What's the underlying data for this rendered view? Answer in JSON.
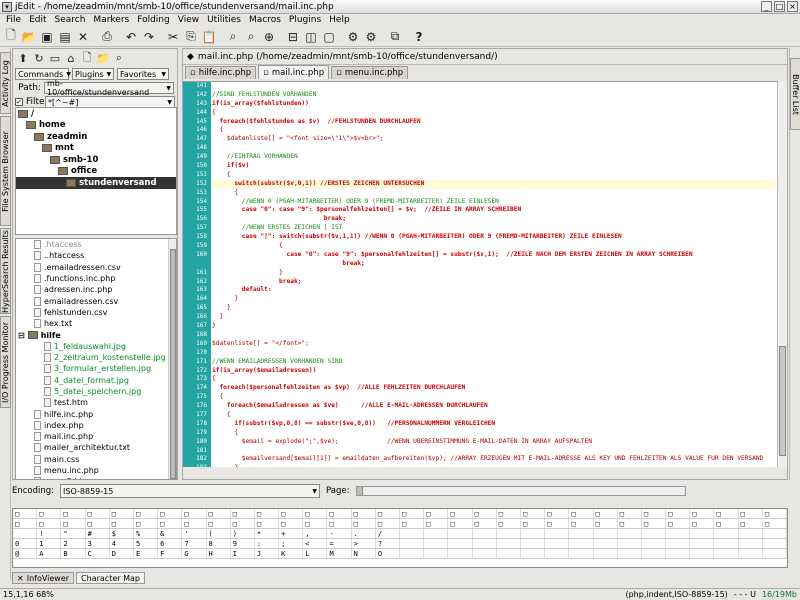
{
  "window": {
    "title": "jEdit - /home/zeadmin/mnt/smb-10/office/stundenversand/mail.inc.php"
  },
  "menu": [
    "File",
    "Edit",
    "Search",
    "Markers",
    "Folding",
    "View",
    "Utilities",
    "Macros",
    "Plugins",
    "Help"
  ],
  "left_vtabs": [
    "Activity Log",
    "File System Browser",
    "HyperSearch Results",
    "I/O Progress Monitor"
  ],
  "right_vtabs": [
    "Buffer List"
  ],
  "browser": {
    "commands": "Commands",
    "plugins": "Plugins",
    "favorites": "Favorites",
    "path_label": "Path:",
    "path_value": "mb-10/office/stundenversand",
    "filter_label": "Filter:",
    "filter_value": "*[^~#]",
    "tree": [
      "/",
      "home",
      "zeadmin",
      "mnt",
      "smb-10",
      "office",
      "stundenversand"
    ],
    "files": [
      {
        "name": ".htaccess",
        "kind": "file",
        "dim": true
      },
      {
        "name": "..htaccess",
        "kind": "file"
      },
      {
        "name": ".emailadressen.csv",
        "kind": "file"
      },
      {
        "name": ".functions.inc.php",
        "kind": "file"
      },
      {
        "name": "adressen.inc.php",
        "kind": "file"
      },
      {
        "name": "emailadressen.csv",
        "kind": "file"
      },
      {
        "name": "fehlstunden.csv",
        "kind": "file"
      },
      {
        "name": "hex.txt",
        "kind": "file"
      },
      {
        "name": "hilfe",
        "kind": "dir"
      },
      {
        "name": "1_feldauswahl.jpg",
        "kind": "sub"
      },
      {
        "name": "2_zeitraum_kostenstelle.jpg",
        "kind": "sub"
      },
      {
        "name": "3_formular_erstellen.jpg",
        "kind": "sub"
      },
      {
        "name": "4_datei_format.jpg",
        "kind": "sub"
      },
      {
        "name": "5_datei_speichern.jpg",
        "kind": "sub"
      },
      {
        "name": "test.htm",
        "kind": "subfile"
      },
      {
        "name": "hilfe.inc.php",
        "kind": "file"
      },
      {
        "name": "index.php",
        "kind": "file"
      },
      {
        "name": "mail.inc.php",
        "kind": "file"
      },
      {
        "name": "mailer_architektur.txt",
        "kind": "file"
      },
      {
        "name": "main.css",
        "kind": "file"
      },
      {
        "name": "menu.inc.php",
        "kind": "file"
      },
      {
        "name": "menu2.htm",
        "kind": "file"
      },
      {
        "name": "menu_bg.gif",
        "kind": "sub2"
      },
      {
        "name": "menu_bg2.gif",
        "kind": "sub2"
      },
      {
        "name": "Mitarbeiter+Emailadressen.xls",
        "kind": "file"
      }
    ]
  },
  "editor": {
    "title": "mail.inc.php (/home/zeadmin/mnt/smb-10/office/stundenversand/)",
    "tabs": [
      "hilfe.inc.php",
      "mail.inc.php",
      "menu.inc.php"
    ],
    "active_tab": 1,
    "lines": [
      {
        "n": "141",
        "t": "",
        "c": ""
      },
      {
        "n": "142",
        "t": "//SIND FEHLSTUNDEN VORHANDEN",
        "c": "cm"
      },
      {
        "n": "143",
        "t": "if(is_array($fehlstunden))",
        "c": "kw"
      },
      {
        "n": "144",
        "t": "{",
        "c": ""
      },
      {
        "n": "145",
        "t": "  foreach($fehlstunden as $v)  //FEHLSTUNDEN DURCHLAUFEN",
        "c": "kw"
      },
      {
        "n": "146",
        "t": "  {",
        "c": ""
      },
      {
        "n": "147",
        "t": "    $datenliste[] = \"<font size=\\\"1\\\">$v<br>\";",
        "c": ""
      },
      {
        "n": "148",
        "t": "",
        "c": ""
      },
      {
        "n": "149",
        "t": "    //EINTRAG VORHANDEN",
        "c": "cm"
      },
      {
        "n": "150",
        "t": "    if($v)",
        "c": "kw"
      },
      {
        "n": "151",
        "t": "    {",
        "c": ""
      },
      {
        "n": "152",
        "t": "      switch(substr($v,0,1)) //ERSTES ZEICHEN UNTERSUCHEN",
        "c": "kw hl"
      },
      {
        "n": "153",
        "t": "      {",
        "c": ""
      },
      {
        "n": "154",
        "t": "        //WENN 0 (PGAH-MITARBEITER) ODER 9 (FREMD-MITARBEITER) ZEILE EINLESEN",
        "c": "cm"
      },
      {
        "n": "155",
        "t": "        case \"0\": case \"9\": $personalfehlzeiten[] = $v;  //ZEILE IN ARRAY SCHREIBEN",
        "c": "kw"
      },
      {
        "n": "156",
        "t": "                              break;",
        "c": "kw"
      },
      {
        "n": "157",
        "t": "        //WENN ERSTES ZEICHEN | IST",
        "c": "cm"
      },
      {
        "n": "158",
        "t": "        case \"|\": switch(substr($v,1,1)) //WENN 0 (PGAH-MITARBEITER) ODER 9 (FREMD-MITARBEITER) ZEILE EINLESEN",
        "c": "kw"
      },
      {
        "n": "159",
        "t": "                  {",
        "c": ""
      },
      {
        "n": "160",
        "t": "                    case \"0\": case \"9\": $personalfehlzeiten[] = substr($v,1);  //ZEILE NACH DEM ERSTEN ZEICHEN IN ARRAY SCHREIBEN",
        "c": "kw"
      },
      {
        "n": "",
        "t": "                                   break;",
        "c": "kw"
      },
      {
        "n": "161",
        "t": "                  }",
        "c": ""
      },
      {
        "n": "162",
        "t": "                  break;",
        "c": "kw"
      },
      {
        "n": "163",
        "t": "        default:",
        "c": "kw"
      },
      {
        "n": "164",
        "t": "      }",
        "c": ""
      },
      {
        "n": "165",
        "t": "    }",
        "c": ""
      },
      {
        "n": "166",
        "t": "  }",
        "c": ""
      },
      {
        "n": "167",
        "t": "}",
        "c": ""
      },
      {
        "n": "168",
        "t": "",
        "c": ""
      },
      {
        "n": "169",
        "t": "$datenliste[] = \"</font>\";",
        "c": ""
      },
      {
        "n": "170",
        "t": "",
        "c": ""
      },
      {
        "n": "171",
        "t": "//WENN EMAILADRESSEN VORHANDEN SIND",
        "c": "cm"
      },
      {
        "n": "172",
        "t": "if(is_array($emailadressen))",
        "c": "kw"
      },
      {
        "n": "173",
        "t": "{",
        "c": ""
      },
      {
        "n": "174",
        "t": "  foreach($personalfehlzeiten as $vp)  //ALLE FEHLZEITEN DURCHLAUFEN",
        "c": "kw"
      },
      {
        "n": "175",
        "t": "  {",
        "c": ""
      },
      {
        "n": "176",
        "t": "    foreach($emailadressen as $ve)      //ALLE E-MAIL-ADRESSEN DURCHLAUFEN",
        "c": "kw"
      },
      {
        "n": "177",
        "t": "    {",
        "c": ""
      },
      {
        "n": "178",
        "t": "      if(substr($vp,0,8) == substr($ve,0,8))   //PERSONALNUMMERN VERGLEICHEN",
        "c": "kw"
      },
      {
        "n": "179",
        "t": "      {",
        "c": ""
      },
      {
        "n": "180",
        "t": "        $email = explode(\";\",$ve);             //WENN ÜBEREINSTIMMUNG E-MAIL-DATEN IN ARRAY AUFSPALTEN",
        "c": ""
      },
      {
        "n": "181",
        "t": "",
        "c": ""
      },
      {
        "n": "182",
        "t": "        $emailversand[$email[1]] = emaildaten_aufbereiten($vp); //ARRAY ERZEUGEN MIT E-MAIL-ADRESSE ALS KEY UND FEHLZEITEN ALS VALUE FÜR DEN VERSAND",
        "c": ""
      },
      {
        "n": "183",
        "t": "      }",
        "c": ""
      },
      {
        "n": "184",
        "t": "    }",
        "c": ""
      },
      {
        "n": "185",
        "t": "  }",
        "c": ""
      },
      {
        "n": "186",
        "t": "}",
        "c": ""
      }
    ]
  },
  "charmap": {
    "encoding_label": "Encoding:",
    "encoding_value": "ISO-8859-15",
    "page_label": "Page:",
    "rows": [
      [
        "□",
        "□",
        "□",
        "□",
        "□",
        "□",
        "□",
        "□",
        "□",
        "□",
        "□",
        "□",
        "□",
        "□",
        "□",
        "□",
        "□",
        "□",
        "□",
        "□",
        "□",
        "□",
        "□",
        "□",
        "□",
        "□",
        "□",
        "□",
        "□",
        "□",
        "□",
        "□"
      ],
      [
        "□",
        "□",
        "□",
        "□",
        "□",
        "□",
        "□",
        "□",
        "□",
        "□",
        "□",
        "□",
        "□",
        "□",
        "□",
        "□",
        "□",
        "□",
        "□",
        "□",
        "□",
        "□",
        "□",
        "□",
        "□",
        "□",
        "□",
        "□",
        "□",
        "□",
        "□",
        "□"
      ],
      [
        "",
        "!",
        "\"",
        "#",
        "$",
        "%",
        "&",
        "'",
        "(",
        ")",
        "*",
        "+",
        ",",
        "-",
        ".",
        "/",
        " ",
        " ",
        " ",
        " ",
        " ",
        " ",
        " ",
        " ",
        " ",
        " ",
        " ",
        " ",
        " ",
        " ",
        " ",
        " "
      ],
      [
        "0",
        "1",
        "2",
        "3",
        "4",
        "5",
        "6",
        "7",
        "8",
        "9",
        ":",
        ";",
        "<",
        "=",
        ">",
        "?",
        " ",
        " ",
        " ",
        " ",
        " ",
        " ",
        " ",
        " ",
        " ",
        " ",
        " ",
        " ",
        " ",
        " ",
        " ",
        " "
      ],
      [
        "@",
        "A",
        "B",
        "C",
        "D",
        "E",
        "F",
        "G",
        "H",
        "I",
        "J",
        "K",
        "L",
        "M",
        "N",
        "O",
        " ",
        " ",
        " ",
        " ",
        " ",
        " ",
        " ",
        " ",
        " ",
        " ",
        " ",
        " ",
        " ",
        " ",
        " ",
        " "
      ]
    ]
  },
  "bottom_tabs": [
    "InfoViewer",
    "Character Map"
  ],
  "status": {
    "left": "15,1,16 68%",
    "mode": "(php,indent,ISO-8859-15)",
    "flags": "- - - U",
    "memory": "16/19Mb"
  }
}
